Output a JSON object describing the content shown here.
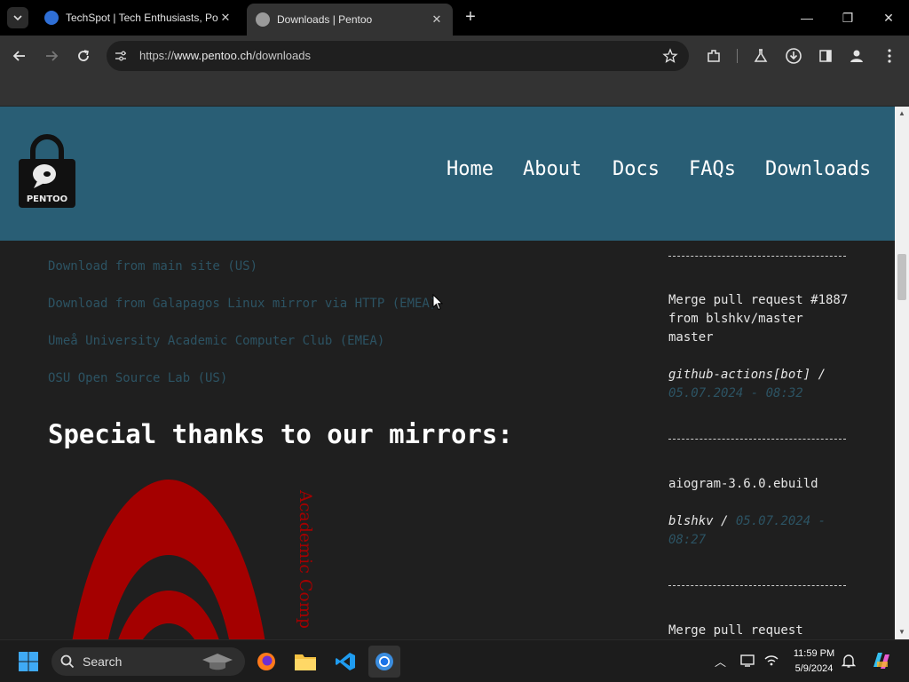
{
  "browser": {
    "tabs": [
      {
        "title": "TechSpot | Tech Enthusiasts, Po",
        "active": false
      },
      {
        "title": "Downloads | Pentoo",
        "active": true
      }
    ],
    "url_prefix": "https://",
    "url_host": "www.pentoo.ch",
    "url_path": "/downloads"
  },
  "site": {
    "logo_text": "PENTOO",
    "nav": [
      "Home",
      "About",
      "Docs",
      "FAQs",
      "Downloads"
    ]
  },
  "mirrors": [
    "Download from main site (US)",
    "Download from Galapagos Linux mirror via HTTP (EMEA)",
    "Umeå University Academic Computer Club (EMEA)",
    "OSU Open Source Lab (US)"
  ],
  "thanks_heading": "Special thanks to our mirrors:",
  "mirror_logo_text": "Academic Comp",
  "commits": [
    {
      "message": "Merge pull request #1887 from blshkv/master master",
      "author": "github-actions[bot]",
      "date": "05.07.2024 - 08:32"
    },
    {
      "message": "aiogram-3.6.0.ebuild",
      "author": "blshkv",
      "date": "05.07.2024 - 08:27"
    },
    {
      "message": "Merge pull request",
      "author": "",
      "date": ""
    }
  ],
  "taskbar": {
    "search_label": "Search",
    "time": "11:59 PM",
    "date": "5/9/2024"
  },
  "colors": {
    "header_bg": "#295e75",
    "page_bg": "#1f1f1f",
    "link": "#2c5363",
    "mirror_logo": "#a40000"
  }
}
